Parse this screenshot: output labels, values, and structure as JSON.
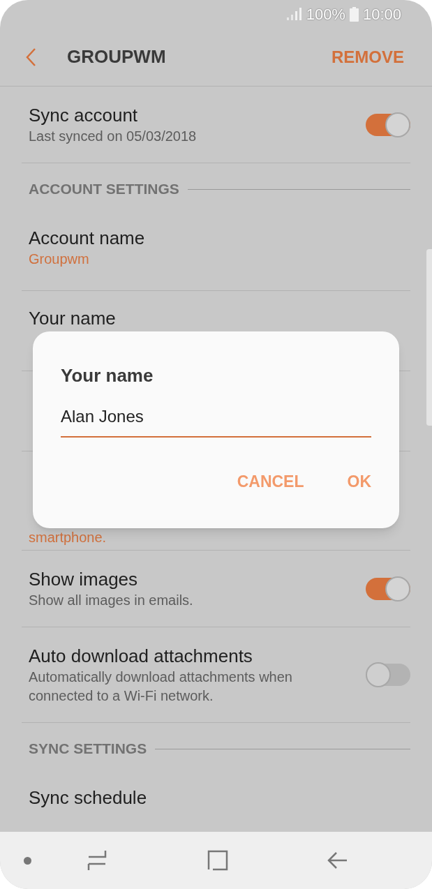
{
  "status_bar": {
    "battery": "100%",
    "time": "10:00"
  },
  "header": {
    "title": "GROUPWM",
    "action": "REMOVE"
  },
  "items": [
    {
      "kind": "toggle",
      "title": "Sync account",
      "subtitle": "Last synced on 05/03/2018",
      "on": true
    },
    {
      "kind": "section",
      "title": "ACCOUNT SETTINGS"
    },
    {
      "kind": "value",
      "title": "Account name",
      "value": "Groupwm"
    },
    {
      "kind": "value",
      "title": "Your name"
    },
    {
      "kind": "covered"
    },
    {
      "kind": "covered",
      "tail": "smartphone."
    },
    {
      "kind": "toggle",
      "title": "Show images",
      "subtitle": "Show all images in emails.",
      "on": true
    },
    {
      "kind": "toggle",
      "title": "Auto download attachments",
      "subtitle": "Automatically download attachments when connected to a Wi-Fi network.",
      "on": false
    },
    {
      "kind": "section",
      "title": "SYNC SETTINGS"
    },
    {
      "kind": "value",
      "title": "Sync schedule"
    }
  ],
  "dialog": {
    "title": "Your name",
    "value": "Alan Jones",
    "buttons": [
      "CANCEL",
      "OK"
    ]
  }
}
